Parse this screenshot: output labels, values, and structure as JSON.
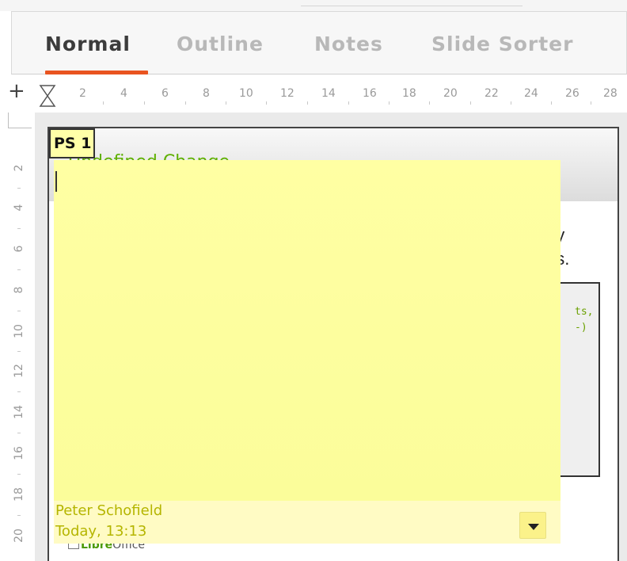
{
  "tabs": [
    {
      "label": "Normal",
      "active": true
    },
    {
      "label": "Outline",
      "active": false
    },
    {
      "label": "Notes",
      "active": false
    },
    {
      "label": "Slide Sorter",
      "active": false
    }
  ],
  "ruler": {
    "horizontal_ticks": [
      "2",
      "4",
      "6",
      "8",
      "10",
      "12",
      "14",
      "16",
      "18",
      "20",
      "22",
      "24",
      "26",
      "28"
    ],
    "vertical_ticks": [
      "2",
      "4",
      "6",
      "8",
      "10",
      "12",
      "14",
      "16",
      "18",
      "20"
    ],
    "add_symbol": "+"
  },
  "slide": {
    "title": "Undefined Change",
    "text_line1": "py",
    "text_line2": "es.",
    "code_line1": "ts,",
    "code_line2": "-)",
    "footer_brand_bold": "Libre",
    "footer_brand_rest": "Office"
  },
  "comment": {
    "label": "PS 1",
    "author": "Peter Schofield",
    "date": "Today, 13:13",
    "menu_icon": "dropdown-triangle-icon"
  },
  "colors": {
    "accent": "#e95420",
    "note_yellow": "#ffffa3",
    "author_text": "#b5b500",
    "title_green": "#5fb000"
  }
}
